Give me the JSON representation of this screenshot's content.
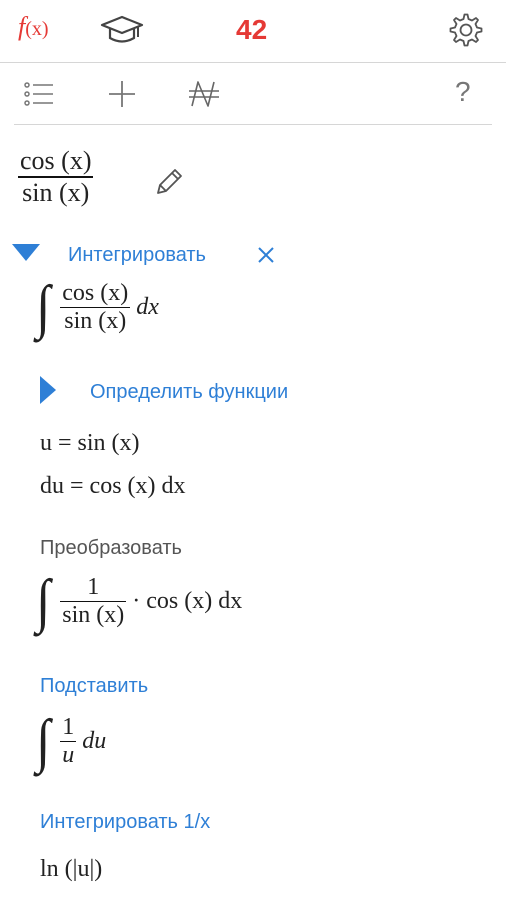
{
  "header": {
    "logo_f": "f",
    "logo_x": "(x)",
    "score": "42",
    "accent": "#e53935"
  },
  "toolbar": {
    "icons": [
      "list-icon",
      "plus-icon",
      "not-equal-icon",
      "help-icon"
    ],
    "help_label": "?"
  },
  "expression": {
    "numerator": "cos (x)",
    "denominator": "sin (x)"
  },
  "steps": {
    "integrate_title": "Интегрировать",
    "integral": {
      "numerator": "cos (x)",
      "denominator": "sin (x)",
      "differential": "dx"
    },
    "define_title": "Определить функции",
    "define_u": "u = sin (x)",
    "define_du": "du = cos (x)  dx",
    "transform_title": "Преобразовать",
    "transform": {
      "numerator": "1",
      "denominator": "sin (x)",
      "rest": "· cos (x) dx"
    },
    "substitute_title": "Подставить",
    "substitute": {
      "numerator": "1",
      "denominator": "u",
      "rest": "du"
    },
    "integrate_1x_title": "Интегрировать 1/x",
    "result": "ln (|u|)"
  },
  "colors": {
    "link": "#2e7fd6",
    "label": "#555555",
    "separator": "#d6d6d6"
  }
}
